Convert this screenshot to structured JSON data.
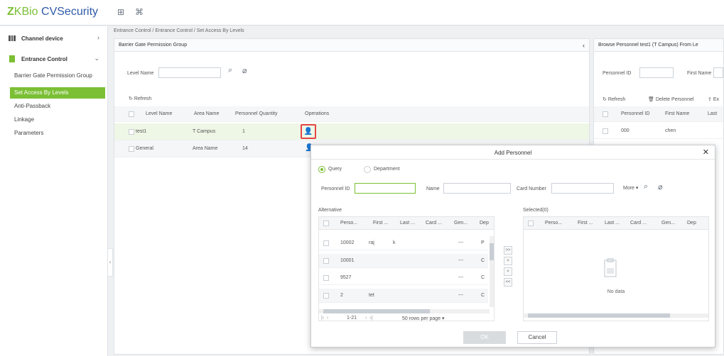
{
  "app": {
    "logo_prefix": "Z",
    "logo_mid": "KBio",
    "logo_suffix": " CVSecurity"
  },
  "topbar": {
    "apps_icon": "apps-grid-icon",
    "collapse_icon": "collapse-icon"
  },
  "sidebar": {
    "group1": "Channel device",
    "group2": "Entrance Control",
    "items": [
      {
        "label": "Barrier Gate Permission Group"
      },
      {
        "label": "Set Access By Levels"
      },
      {
        "label": "Anti-Passback"
      },
      {
        "label": "Linkage"
      },
      {
        "label": "Parameters"
      }
    ]
  },
  "breadcrumb": "Entrance Control / Entrance Control / Set Access By Levels",
  "left_panel": {
    "title": "Barrier Gate Permission Group",
    "level_name_label": "Level Name",
    "refresh": "Refresh",
    "columns": [
      "Level Name",
      "Area Name",
      "Personnel Quantity",
      "Operations"
    ],
    "rows": [
      {
        "level": "test1",
        "area": "T Campus",
        "qty": "1"
      },
      {
        "level": "General",
        "area": "Area Name",
        "qty": "14"
      }
    ]
  },
  "right_panel": {
    "title": "Browse Personnel test1 (T Campus) From Le",
    "personnel_id_label": "Personnel ID",
    "first_name_label": "First Name",
    "refresh": "Refresh",
    "delete": "Delete Personnel",
    "export": "Ex",
    "columns": [
      "Personnel ID",
      "First Name",
      "Last"
    ],
    "rows": [
      {
        "id": "000",
        "first": "chen"
      }
    ]
  },
  "dialog": {
    "title": "Add Personnel",
    "radio_query": "Query",
    "radio_department": "Department",
    "personnel_id_label": "Personnel ID",
    "name_label": "Name",
    "card_number_label": "Card Number",
    "more": "More",
    "alternative_label": "Alternative",
    "selected_label": "Selected(0)",
    "columns": [
      "Perso...",
      "First ...",
      "Last ...",
      "Card ...",
      "Gen...",
      "Dep"
    ],
    "alt_rows": [
      {
        "id": "10002",
        "first": "raj",
        "last": "k",
        "gen": "---",
        "dep": "P"
      },
      {
        "id": "10001",
        "first": "",
        "last": "",
        "gen": "---",
        "dep": "C"
      },
      {
        "id": "9527",
        "first": "",
        "last": "",
        "gen": "---",
        "dep": "C"
      },
      {
        "id": "2",
        "first": "tet",
        "last": "",
        "gen": "---",
        "dep": "C"
      }
    ],
    "pager_range": "1-21",
    "pager_rows": "50 rows per page",
    "no_data": "No data",
    "ok": "OK",
    "cancel": "Cancel",
    "move_buttons": [
      ">>",
      ">",
      "<",
      "<<"
    ]
  }
}
